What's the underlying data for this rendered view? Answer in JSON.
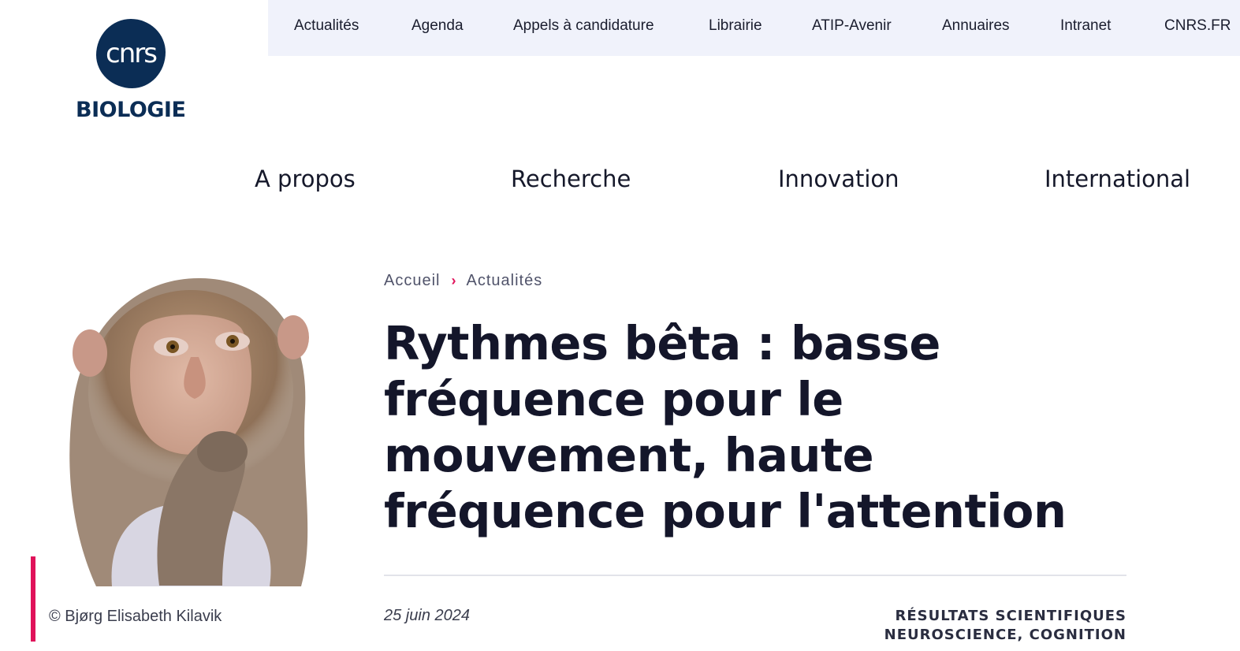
{
  "logo": {
    "mark": "cnrs",
    "subtitle": "BIOLOGIE",
    "brand_color": "#0b2d55"
  },
  "topnav": [
    "Actualités",
    "Agenda",
    "Appels à candidature",
    "Librairie",
    "ATIP-Avenir",
    "Annuaires",
    "Intranet",
    "CNRS.FR"
  ],
  "mainnav": [
    "A propos",
    "Recherche",
    "Innovation",
    "International"
  ],
  "breadcrumb": {
    "home": "Accueil",
    "section": "Actualités"
  },
  "article": {
    "title": "Rythmes bêta : basse fréquence pour le mouvement, haute fréquence pour l'attention",
    "date": "25 juin 2024",
    "category": "RÉSULTATS SCIENTIFIQUES",
    "topics": "NEUROSCIENCE, COGNITION"
  },
  "image": {
    "credit": "© Bjørg Elisabeth Kilavik"
  },
  "colors": {
    "accent": "#e0125a",
    "topbar_bg": "#f0f2fb"
  }
}
